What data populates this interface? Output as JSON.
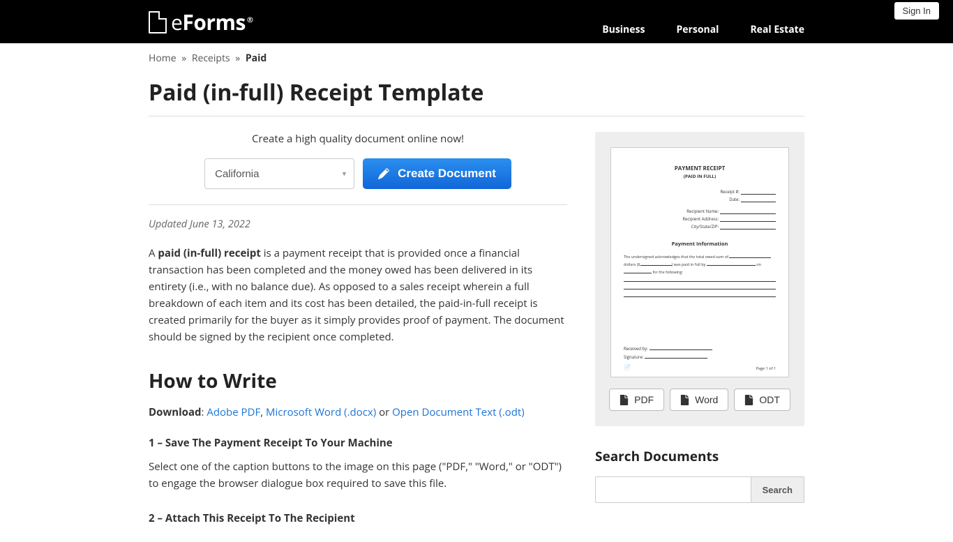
{
  "header": {
    "sign_in": "Sign In",
    "logo_text": "Forms",
    "logo_prefix": "e",
    "nav": [
      "Business",
      "Personal",
      "Real Estate"
    ]
  },
  "breadcrumb": {
    "items": [
      "Home",
      "Receipts"
    ],
    "current": "Paid",
    "sep": "»"
  },
  "title": "Paid (in-full) Receipt Template",
  "create": {
    "prompt": "Create a high quality document online now!",
    "state": "California",
    "button": "Create Document"
  },
  "updated": "Updated June 13, 2022",
  "intro": {
    "prefix": "A ",
    "bold": "paid (in-full) receipt",
    "rest": " is a payment receipt that is provided once a financial transaction has been completed and the money owed has been delivered in its entirety (i.e., with no balance due). As opposed to a sales receipt wherein a full breakdown of each item and its cost has been detailed, the paid-in-full receipt is created primarily for the buyer as it simply provides proof of payment. The document should be signed by the recipient once completed."
  },
  "howto": {
    "heading": "How to Write",
    "download_label": "Download",
    "download_sep1": ": ",
    "download_links": [
      "Adobe PDF",
      "Microsoft Word (.docx)",
      "Open Document Text (.odt)"
    ],
    "download_sep_comma": ", ",
    "download_or": " or ",
    "steps": [
      {
        "title": "1 – Save The Payment Receipt To Your Machine",
        "text": "Select one of the caption buttons to the image on this page (\"PDF,\" \"Word,\" or \"ODT\") to engage the browser dialogue box required to save this file."
      },
      {
        "title": "2 – Attach This Receipt To The Recipient",
        "text": ""
      }
    ]
  },
  "preview": {
    "title": "PAYMENT RECEIPT",
    "subtitle": "(PAID IN FULL)",
    "receipt_no": "Receipt #:",
    "date": "Date:",
    "recipient_name": "Recipient Name:",
    "recipient_address": "Recipient Address:",
    "city_state_zip": "City/State/ZIP:",
    "section": "Payment Information",
    "body1": "The undersigned acknowledges that the total owed sum of",
    "body2": "dollars ($",
    "body3": ") was paid in full by",
    "body4": "on",
    "body5": "for the following:",
    "received_by": "Received by:",
    "signature": "Signature:",
    "page": "Page 1 of 1"
  },
  "downloads": [
    "PDF",
    "Word",
    "ODT"
  ],
  "search": {
    "title": "Search Documents",
    "button": "Search",
    "placeholder": ""
  }
}
